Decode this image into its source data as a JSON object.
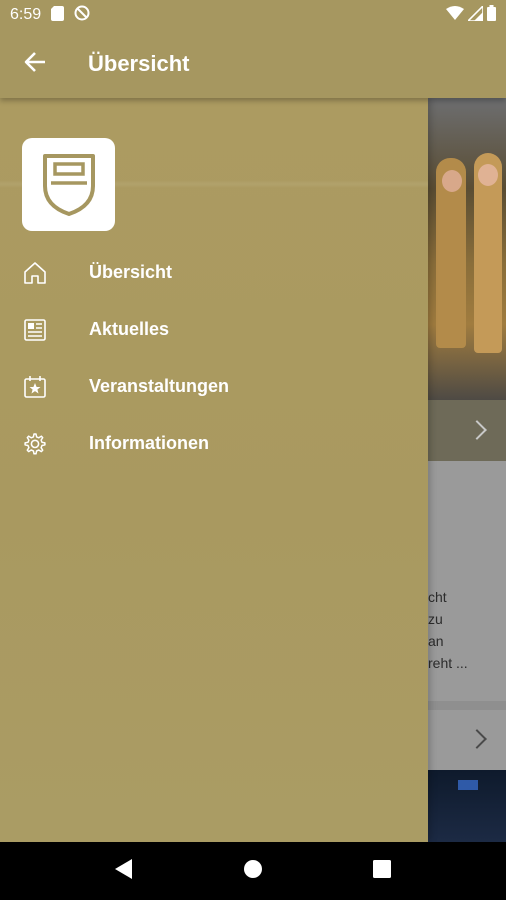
{
  "status_bar": {
    "time": "6:59",
    "left_icons": [
      "sd-card-icon",
      "no-disturb-icon"
    ],
    "right_icons": [
      "wifi-icon",
      "signal-icon",
      "battery-icon"
    ]
  },
  "app_bar": {
    "title": "Übersicht",
    "back_icon": "arrow-back-icon"
  },
  "drawer": {
    "logo": "shield-logo-icon",
    "items": [
      {
        "label": "Übersicht",
        "icon": "home-icon"
      },
      {
        "label": "Aktuelles",
        "icon": "newspaper-icon"
      },
      {
        "label": "Veranstaltungen",
        "icon": "calendar-star-icon"
      },
      {
        "label": "Informationen",
        "icon": "gear-icon"
      }
    ]
  },
  "background_content": {
    "card_text_lines": [
      "cht",
      "zu",
      "an",
      "reht ..."
    ]
  },
  "nav_bar": {
    "buttons": [
      "back-triangle-icon",
      "home-circle-icon",
      "recents-square-icon"
    ]
  },
  "colors": {
    "primary": "#a69760",
    "drawer": "#ab9b62",
    "text_on_primary": "#ffffff"
  }
}
